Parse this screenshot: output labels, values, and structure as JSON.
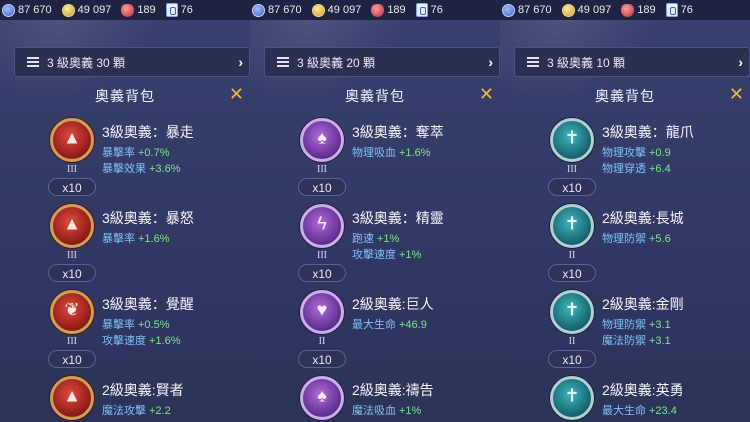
{
  "resources": {
    "gems": "87 670",
    "coins": "49 097",
    "rubies": "189",
    "cards": "76"
  },
  "panels": [
    {
      "sort_label": "3 級奧義 30 顆",
      "title": "奧義背包",
      "items": [
        {
          "color": "red",
          "icon": "flame-icon",
          "tier": "III",
          "qty": "x10",
          "name": "3級奧義：暴走",
          "stats": [
            {
              "label": "暴擊率",
              "value": "+0.7%"
            },
            {
              "label": "暴擊效果",
              "value": "+3.6%"
            }
          ]
        },
        {
          "color": "red",
          "icon": "flame-icon",
          "tier": "III",
          "qty": "x10",
          "name": "3級奧義：暴怒",
          "stats": [
            {
              "label": "暴擊率",
              "value": "+1.6%"
            }
          ]
        },
        {
          "color": "red",
          "icon": "feather-icon",
          "tier": "III",
          "qty": "x10",
          "name": "3級奧義：覺醒",
          "stats": [
            {
              "label": "暴擊率",
              "value": "+0.5%"
            },
            {
              "label": "攻擊速度",
              "value": "+1.6%"
            }
          ]
        },
        {
          "color": "red",
          "icon": "flame-icon",
          "tier": "",
          "qty": "",
          "name": "2級奧義:賢者",
          "stats": [
            {
              "label": "魔法攻擊",
              "value": "+2.2"
            }
          ]
        }
      ]
    },
    {
      "sort_label": "3 級奧義 20 顆",
      "title": "奧義背包",
      "items": [
        {
          "color": "purple",
          "icon": "spade-icon",
          "tier": "III",
          "qty": "x10",
          "name": "3級奧義：奪萃",
          "stats": [
            {
              "label": "物理吸血",
              "value": "+1.6%"
            }
          ]
        },
        {
          "color": "purple",
          "icon": "lightning-icon",
          "tier": "III",
          "qty": "x10",
          "name": "3級奧義：精靈",
          "stats": [
            {
              "label": "跑速",
              "value": "+1%"
            },
            {
              "label": "攻擊速度",
              "value": "+1%"
            }
          ]
        },
        {
          "color": "purple",
          "icon": "heart-icon",
          "tier": "II",
          "qty": "x10",
          "name": "2級奧義:巨人",
          "stats": [
            {
              "label": "最大生命",
              "value": "+46.9"
            }
          ]
        },
        {
          "color": "purple",
          "icon": "spade-icon",
          "tier": "",
          "qty": "",
          "name": "2級奧義:禱告",
          "stats": [
            {
              "label": "魔法吸血",
              "value": "+1%"
            }
          ]
        }
      ]
    },
    {
      "sort_label": "3 級奧義 10 顆",
      "title": "奧義背包",
      "items": [
        {
          "color": "teal",
          "icon": "sword-icon",
          "tier": "III",
          "qty": "x10",
          "name": "3級奧義：龍爪",
          "stats": [
            {
              "label": "物理攻擊",
              "value": "+0.9"
            },
            {
              "label": "物理穿透",
              "value": "+6.4"
            }
          ]
        },
        {
          "color": "teal",
          "icon": "sword-icon",
          "tier": "II",
          "qty": "x10",
          "name": "2級奧義:長城",
          "stats": [
            {
              "label": "物理防禦",
              "value": "+5.6"
            }
          ]
        },
        {
          "color": "teal",
          "icon": "sword-icon",
          "tier": "II",
          "qty": "x10",
          "name": "2級奧義:金剛",
          "stats": [
            {
              "label": "物理防禦",
              "value": "+3.1"
            },
            {
              "label": "魔法防禦",
              "value": "+3.1"
            }
          ]
        },
        {
          "color": "teal",
          "icon": "sword-icon",
          "tier": "",
          "qty": "",
          "name": "2級奧義:英勇",
          "stats": [
            {
              "label": "最大生命",
              "value": "+23.4"
            }
          ]
        }
      ]
    }
  ],
  "icon_glyphs": {
    "flame-icon": "▲",
    "feather-icon": "❦",
    "spade-icon": "♠",
    "lightning-icon": "ϟ",
    "heart-icon": "♥",
    "sword-icon": "✝"
  },
  "colors": {
    "stat_label": "#7ec3f7",
    "stat_value": "#7ee58b",
    "close": "#f2b83a"
  }
}
